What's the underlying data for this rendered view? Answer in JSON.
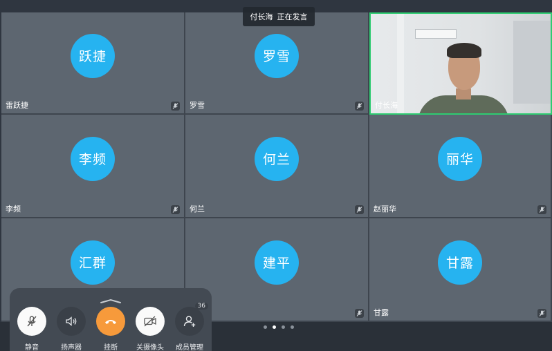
{
  "speaker_banner": {
    "name": "付长海",
    "status": "正在发言"
  },
  "participants": [
    {
      "avatar": "跃捷",
      "name": "雷跃捷"
    },
    {
      "avatar": "罗雪",
      "name": "罗雪"
    },
    {
      "avatar": "",
      "name": "付长海"
    },
    {
      "avatar": "李频",
      "name": "李频"
    },
    {
      "avatar": "何兰",
      "name": "何兰"
    },
    {
      "avatar": "丽华",
      "name": "赵丽华"
    },
    {
      "avatar": "汇群",
      "name": ""
    },
    {
      "avatar": "建平",
      "name": ""
    },
    {
      "avatar": "甘露",
      "name": "甘露"
    }
  ],
  "controls": {
    "mute": "静音",
    "speaker": "扬声器",
    "hangup": "挂断",
    "camera_off": "关摄像头",
    "members": "成员管理",
    "member_count": "36"
  },
  "pagination": {
    "pages": 4,
    "current": 2
  },
  "colors": {
    "avatar": "#26b3f0",
    "hangup": "#f79a3b",
    "speaking_border": "#2ecc71"
  }
}
